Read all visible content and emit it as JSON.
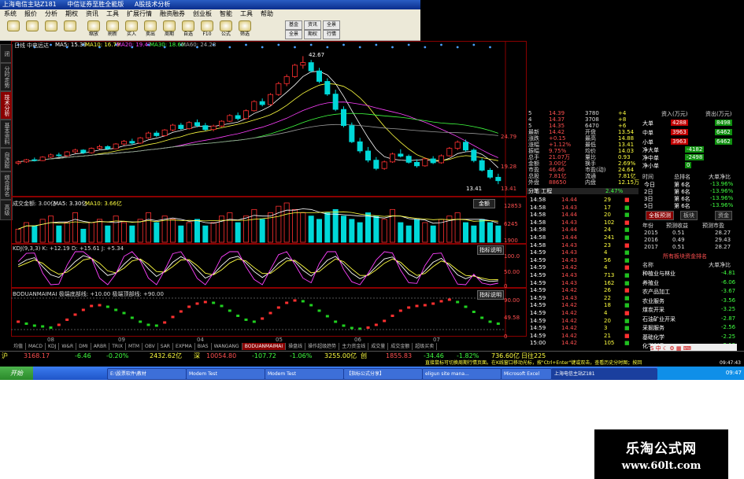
{
  "window": {
    "title_parts": [
      "上海电信主站Z181",
      "中信证券至胜全能版",
      "A股技术分析"
    ]
  },
  "menu": [
    "系统",
    "报价",
    "分析",
    "期权",
    "资讯",
    "工具",
    "扩展行情",
    "融资融券",
    "创业板",
    "智能",
    "工具",
    "帮助"
  ],
  "toolbar": [
    {
      "icon": "back-icon",
      "label": ""
    },
    {
      "icon": "forward-icon",
      "label": ""
    },
    {
      "icon": "up-icon",
      "label": ""
    },
    {
      "icon": "down-icon",
      "label": ""
    },
    {
      "icon": "zoom-icon",
      "label": "缩放"
    },
    {
      "icon": "refresh-icon",
      "label": "刷新"
    },
    {
      "icon": "buy-icon",
      "label": "买入"
    },
    {
      "icon": "sell-icon",
      "label": "卖出"
    },
    {
      "icon": "period-icon",
      "label": "周期"
    },
    {
      "icon": "self-select-icon",
      "label": "自选"
    },
    {
      "icon": "f10-icon",
      "label": "F10"
    },
    {
      "icon": "formula-icon",
      "label": "公式"
    },
    {
      "icon": "filter-icon",
      "label": "筛选"
    }
  ],
  "toolbar_right": [
    "基金",
    "全景",
    "资讯",
    "期权",
    "全景",
    "行情"
  ],
  "left_tabs": [
    "分时走势",
    "技术分析",
    "基本资料",
    "自选股",
    "综合排名",
    "高级"
  ],
  "chart": {
    "period_label": "日线",
    "stock_name": "中电远达",
    "ma5": "MA5: 15.39",
    "ma10": "MA10: 16.79",
    "ma20": "MA20: 19.47",
    "ma30": "MA30: 18.60",
    "ma60": "MA60: 24.28",
    "high_label": "42.67",
    "low_label": "13.41",
    "axis": [
      "24.79",
      "19.28",
      "13.41"
    ],
    "volume_title": "成交金额: 3.00亿",
    "volume_ma5": "MA5: 3.30亿",
    "volume_ma10": "MA10: 3.66亿",
    "volume_axis": [
      "12853",
      "6245",
      "1900"
    ],
    "kdj_title": "KDJ(9,3,3) K: +12.19 D: +15.61 J: +5.34",
    "kdj_axis": [
      "100.0",
      "50.00",
      "0"
    ],
    "kdj_button": "指标说明",
    "bod_title": "BODUANMAIMAI 极端底部线: +10.00 极端顶部线: +90.00",
    "bod_axis": [
      "90.00",
      "49.58",
      "0"
    ],
    "bod_button": "指标说明",
    "dropdown_label": "金额",
    "dates": [
      "08",
      "09",
      "04",
      "05",
      "06",
      "07"
    ]
  },
  "candles": [
    {
      "o": 18.2,
      "h": 18.8,
      "l": 17.8,
      "c": 18.5
    },
    {
      "o": 18.5,
      "h": 19.2,
      "l": 18.3,
      "c": 19.0
    },
    {
      "o": 19.0,
      "h": 19.5,
      "l": 18.6,
      "c": 18.8
    },
    {
      "o": 18.8,
      "h": 19.8,
      "l": 18.7,
      "c": 19.6
    },
    {
      "o": 19.6,
      "h": 20.4,
      "l": 19.4,
      "c": 20.1
    },
    {
      "o": 20.1,
      "h": 20.6,
      "l": 19.6,
      "c": 19.9
    },
    {
      "o": 19.9,
      "h": 21.0,
      "l": 19.7,
      "c": 20.8
    },
    {
      "o": 20.8,
      "h": 21.5,
      "l": 20.5,
      "c": 21.2
    },
    {
      "o": 21.2,
      "h": 21.4,
      "l": 20.3,
      "c": 20.6
    },
    {
      "o": 20.6,
      "h": 21.8,
      "l": 20.4,
      "c": 21.6
    },
    {
      "o": 21.6,
      "h": 22.4,
      "l": 21.3,
      "c": 22.0
    },
    {
      "o": 22.0,
      "h": 22.3,
      "l": 21.2,
      "c": 21.5
    },
    {
      "o": 21.5,
      "h": 22.8,
      "l": 21.4,
      "c": 22.6
    },
    {
      "o": 22.6,
      "h": 23.5,
      "l": 22.3,
      "c": 23.2
    },
    {
      "o": 23.2,
      "h": 23.8,
      "l": 22.4,
      "c": 22.8
    },
    {
      "o": 22.8,
      "h": 24.2,
      "l": 22.6,
      "c": 24.0
    },
    {
      "o": 24.0,
      "h": 25.4,
      "l": 23.8,
      "c": 25.1
    },
    {
      "o": 25.1,
      "h": 25.6,
      "l": 24.2,
      "c": 24.5
    },
    {
      "o": 24.5,
      "h": 26.0,
      "l": 24.3,
      "c": 25.8
    },
    {
      "o": 25.8,
      "h": 27.2,
      "l": 25.5,
      "c": 26.9
    },
    {
      "o": 26.9,
      "h": 27.4,
      "l": 25.8,
      "c": 26.1
    },
    {
      "o": 26.1,
      "h": 27.8,
      "l": 25.9,
      "c": 27.5
    },
    {
      "o": 27.5,
      "h": 28.2,
      "l": 26.4,
      "c": 26.8
    },
    {
      "o": 26.8,
      "h": 27.4,
      "l": 25.6,
      "c": 25.9
    },
    {
      "o": 25.9,
      "h": 27.0,
      "l": 25.5,
      "c": 26.7
    },
    {
      "o": 26.7,
      "h": 28.0,
      "l": 26.5,
      "c": 27.8
    },
    {
      "o": 27.8,
      "h": 29.4,
      "l": 27.6,
      "c": 29.1
    },
    {
      "o": 29.1,
      "h": 29.8,
      "l": 28.0,
      "c": 28.4
    },
    {
      "o": 28.4,
      "h": 30.5,
      "l": 28.2,
      "c": 30.2
    },
    {
      "o": 30.2,
      "h": 32.6,
      "l": 30.0,
      "c": 32.3
    },
    {
      "o": 32.3,
      "h": 33.0,
      "l": 31.2,
      "c": 31.6
    },
    {
      "o": 31.6,
      "h": 34.2,
      "l": 31.4,
      "c": 33.9
    },
    {
      "o": 33.9,
      "h": 36.8,
      "l": 33.6,
      "c": 36.4
    },
    {
      "o": 36.4,
      "h": 38.5,
      "l": 35.8,
      "c": 38.0
    },
    {
      "o": 38.0,
      "h": 40.9,
      "l": 37.7,
      "c": 40.6
    },
    {
      "o": 40.6,
      "h": 42.67,
      "l": 39.8,
      "c": 41.2
    },
    {
      "o": 41.2,
      "h": 41.8,
      "l": 38.9,
      "c": 39.3
    },
    {
      "o": 39.3,
      "h": 40.0,
      "l": 36.5,
      "c": 36.9
    },
    {
      "o": 36.9,
      "h": 37.6,
      "l": 33.6,
      "c": 34.0
    },
    {
      "o": 34.0,
      "h": 35.0,
      "l": 30.1,
      "c": 30.5
    },
    {
      "o": 30.5,
      "h": 31.2,
      "l": 26.4,
      "c": 26.8
    },
    {
      "o": 26.8,
      "h": 27.5,
      "l": 22.8,
      "c": 23.1
    },
    {
      "o": 23.1,
      "h": 24.0,
      "l": 20.5,
      "c": 21.0
    },
    {
      "o": 21.0,
      "h": 21.9,
      "l": 18.4,
      "c": 18.9
    },
    {
      "o": 18.9,
      "h": 19.6,
      "l": 16.6,
      "c": 17.0
    },
    {
      "o": 17.0,
      "h": 18.8,
      "l": 16.7,
      "c": 18.5
    },
    {
      "o": 18.5,
      "h": 20.6,
      "l": 18.3,
      "c": 20.3
    },
    {
      "o": 20.3,
      "h": 21.4,
      "l": 19.5,
      "c": 19.8
    },
    {
      "o": 19.8,
      "h": 20.2,
      "l": 18.1,
      "c": 18.4
    },
    {
      "o": 18.4,
      "h": 19.1,
      "l": 17.2,
      "c": 17.6
    },
    {
      "o": 17.6,
      "h": 19.5,
      "l": 17.4,
      "c": 19.2
    },
    {
      "o": 19.2,
      "h": 19.8,
      "l": 18.0,
      "c": 18.3
    },
    {
      "o": 18.3,
      "h": 20.2,
      "l": 18.1,
      "c": 19.9
    },
    {
      "o": 19.9,
      "h": 21.9,
      "l": 19.7,
      "c": 21.6
    },
    {
      "o": 21.6,
      "h": 23.4,
      "l": 21.2,
      "c": 23.0
    },
    {
      "o": 23.0,
      "h": 23.6,
      "l": 20.8,
      "c": 21.2
    },
    {
      "o": 21.2,
      "h": 21.6,
      "l": 18.4,
      "c": 18.8
    },
    {
      "o": 18.8,
      "h": 19.3,
      "l": 16.3,
      "c": 16.6
    },
    {
      "o": 16.6,
      "h": 17.1,
      "l": 14.6,
      "c": 15.0
    },
    {
      "o": 15.0,
      "h": 15.8,
      "l": 13.41,
      "c": 14.2
    }
  ],
  "volumes": [
    4,
    6,
    5,
    7,
    8,
    5,
    6,
    9,
    4,
    6,
    7,
    5,
    8,
    6,
    5,
    7,
    9,
    6,
    8,
    7,
    5,
    6,
    7,
    5,
    6,
    8,
    9,
    6,
    8,
    10,
    7,
    9,
    11,
    12,
    10,
    9,
    8,
    7,
    9,
    10,
    8,
    7,
    6,
    9,
    8,
    7,
    10,
    6,
    5,
    7,
    6,
    5,
    7,
    8,
    9,
    6,
    5,
    7,
    6,
    5
  ],
  "kdj_k": [
    60,
    75,
    82,
    55,
    30,
    22,
    45,
    70,
    88,
    80,
    50,
    28,
    35,
    62,
    84,
    76,
    48,
    25,
    40,
    68,
    85,
    72,
    45,
    20,
    32,
    58,
    80,
    86,
    66,
    40,
    22,
    38,
    65,
    82,
    70,
    44,
    26,
    48,
    74,
    86,
    62,
    35,
    18,
    30,
    55,
    78,
    84,
    60,
    32,
    20,
    42,
    68,
    80,
    58,
    30,
    18,
    28,
    15,
    10,
    12
  ],
  "kdj_d": [
    55,
    65,
    75,
    65,
    45,
    32,
    38,
    55,
    75,
    80,
    65,
    42,
    36,
    50,
    72,
    78,
    62,
    40,
    38,
    55,
    75,
    76,
    58,
    35,
    30,
    45,
    66,
    78,
    72,
    52,
    34,
    34,
    52,
    72,
    74,
    56,
    36,
    40,
    60,
    78,
    70,
    48,
    28,
    28,
    45,
    65,
    78,
    68,
    45,
    28,
    34,
    55,
    72,
    64,
    44,
    28,
    26,
    20,
    15,
    15.61
  ],
  "bod_values": [
    30,
    25,
    20,
    18,
    15,
    22,
    35,
    48,
    60,
    70,
    72,
    68,
    60,
    52,
    40,
    30,
    22,
    20,
    28,
    42,
    56,
    68,
    76,
    80,
    78,
    70,
    58,
    45,
    35,
    30,
    38,
    52,
    66,
    78,
    84,
    82,
    72,
    58,
    44,
    30,
    20,
    14,
    12,
    15,
    22,
    32,
    45,
    58,
    66,
    70,
    72,
    76,
    82,
    86,
    80,
    68,
    55,
    40,
    30,
    25
  ],
  "right_panel": {
    "rows": [
      {
        "a": "5",
        "b": "14.39",
        "c": "3780",
        "d": "+4"
      },
      {
        "a": "4",
        "b": "14.37",
        "c": "3708",
        "d": "+8"
      },
      {
        "a": "5",
        "b": "14.35",
        "c": "6470",
        "d": "+6"
      },
      {
        "a": "最新",
        "b": "14.42",
        "c": "开盘",
        "d": "13.54"
      },
      {
        "a": "涨跌",
        "b": "+0.15",
        "c": "最高",
        "d": "14.88"
      },
      {
        "a": "涨幅",
        "b": "+1.12%",
        "c": "最低",
        "d": "13.41"
      },
      {
        "a": "振幅",
        "b": "9.75%",
        "c": "均价",
        "d": "14.03"
      },
      {
        "a": "总手",
        "b": "21.07万",
        "c": "量比",
        "d": "0.93"
      },
      {
        "a": "金额",
        "b": "3.00亿",
        "c": "换手",
        "d": "2.69%"
      },
      {
        "a": "市盈",
        "b": "46.46",
        "c": "市盈(动)",
        "d": "24.64"
      },
      {
        "a": "总股",
        "b": "7.81亿",
        "c": "流通",
        "d": "7.81亿"
      },
      {
        "a": "外盘",
        "b": "88650",
        "c": "内盘",
        "d": "12.15万"
      }
    ],
    "tick_header": "分笔 工程",
    "tick_header_right": "2.47%",
    "ticks": [
      {
        "t": "14:58",
        "p": "14.44",
        "v": "29"
      },
      {
        "t": "14:58",
        "p": "14.43",
        "v": "17"
      },
      {
        "t": "14:58",
        "p": "14.44",
        "v": "20"
      },
      {
        "t": "14:58",
        "p": "14.43",
        "v": "102"
      },
      {
        "t": "14:58",
        "p": "14.44",
        "v": "24"
      },
      {
        "t": "14:58",
        "p": "14.44",
        "v": "241"
      },
      {
        "t": "14:58",
        "p": "14.43",
        "v": "23"
      },
      {
        "t": "14:59",
        "p": "14.43",
        "v": "4"
      },
      {
        "t": "14:59",
        "p": "14.43",
        "v": "56"
      },
      {
        "t": "14:59",
        "p": "14.42",
        "v": "4"
      },
      {
        "t": "14:59",
        "p": "14.43",
        "v": "713"
      },
      {
        "t": "14:59",
        "p": "14.43",
        "v": "162"
      },
      {
        "t": "14:59",
        "p": "14.42",
        "v": "26"
      },
      {
        "t": "14:59",
        "p": "14.43",
        "v": "22"
      },
      {
        "t": "14:59",
        "p": "14.42",
        "v": "18"
      },
      {
        "t": "14:59",
        "p": "14.42",
        "v": "4"
      },
      {
        "t": "14:59",
        "p": "14.42",
        "v": "20"
      },
      {
        "t": "14:59",
        "p": "14.42",
        "v": "3"
      },
      {
        "t": "14:59",
        "p": "14.42",
        "v": "21"
      },
      {
        "t": "15:00",
        "p": "14.42",
        "v": "105"
      }
    ]
  },
  "fund_panel": {
    "header": [
      "资入(万元)",
      "资出(万元)"
    ],
    "rows": [
      {
        "label": "大单",
        "in": "4288",
        "out": "8498"
      },
      {
        "label": "中单",
        "in": "3963",
        "out": "6462"
      },
      {
        "label": "小单",
        "in": "3963",
        "out": "6462"
      }
    ],
    "net": [
      {
        "label": "净大单",
        "value": "-4182"
      },
      {
        "label": "净中单",
        "value": "-2498"
      },
      {
        "label": "净小单",
        "value": "0"
      }
    ],
    "rank_header": [
      "时间",
      "总排名",
      "大单净比"
    ],
    "ranks": [
      {
        "t": "今日",
        "r": "第 6名",
        "v": "-13.96%"
      },
      {
        "t": "2日",
        "r": "第 6名",
        "v": "-13.96%"
      },
      {
        "t": "3日",
        "r": "第 6名",
        "v": "-13.96%"
      },
      {
        "t": "5日",
        "r": "第 6名",
        "v": "-13.96%"
      }
    ],
    "tabs": [
      "全板预测",
      "板块",
      "资金"
    ],
    "forecast_header": [
      "年份",
      "预测收益",
      "预测市盈"
    ],
    "forecast": [
      {
        "y": "2015",
        "a": "0.51",
        "b": "28.27"
      },
      {
        "y": "2016",
        "a": "0.49",
        "b": "29.43"
      },
      {
        "y": "2017",
        "a": "0.51",
        "b": "28.27"
      }
    ],
    "sector_title": "所有板块资金排名",
    "sector_header": [
      "名称",
      "大单净比"
    ],
    "sectors": [
      {
        "n": "种植业与林业",
        "v": "-4.81"
      },
      {
        "n": "养殖业",
        "v": "-6.06"
      },
      {
        "n": "农产品加工",
        "v": "-3.67"
      },
      {
        "n": "农业服务",
        "v": "-3.56"
      },
      {
        "n": "煤炭开采",
        "v": "-3.25"
      },
      {
        "n": "石油矿业开采",
        "v": "-2.87"
      },
      {
        "n": "采掘服务",
        "v": "-2.56"
      },
      {
        "n": "基础化学",
        "v": "-2.25"
      },
      {
        "n": "化学制品",
        "v": "-2.13"
      }
    ]
  },
  "bottom_tabs": [
    "均值",
    "MACD",
    "KDJ",
    "W&R",
    "DMI",
    "ARBR",
    "TRIX",
    "MTM",
    "OBV",
    "SAR",
    "EXPMA",
    "BIAS",
    "WANGANG",
    "BODUANMAIMAI",
    "操盘线",
    "操作超级趋势",
    "主力资金线",
    "成交量",
    "成交金额",
    "超级买卖"
  ],
  "bottom_tab_active": "BODUANMAIMAI",
  "ticker": {
    "left_label": "沪",
    "items": [
      "3168.17",
      "-6.46",
      "-0.20%",
      "2432.62亿",
      "深",
      "10054.80",
      "-107.72",
      "-1.06%",
      "3255.00亿",
      "创",
      "1855.83",
      "-34.46",
      "-1.82%",
      "736.60亿",
      "日往225"
    ],
    "notice": "直接鼠标可切换周期行情页面。在K线窗口移动光标，按\"Ctrl+Enter\"键或双击，查看历史分时图；按回",
    "clock": "09:47:43"
  },
  "taskbar": {
    "start": "开始",
    "tasks": [
      "E:\\股票软件\\教材",
      "Modem Test",
      "Modem Test",
      "【指标公式分享】",
      "eligun site mana...",
      "Microsoft Excel",
      "上海电信主站Z181"
    ],
    "time": "09:47"
  },
  "watermark": {
    "line1": "乐淘公式网",
    "line2": "www.60lt.com"
  },
  "colors": {
    "up": "#ff3030",
    "down": "#00d8d8",
    "bg": "#000000",
    "grid": "#8a0000"
  }
}
